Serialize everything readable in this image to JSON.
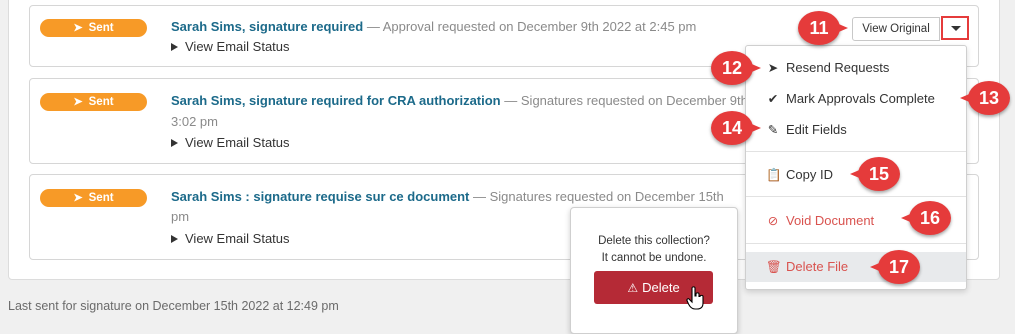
{
  "records": [
    {
      "status": "Sent",
      "title": "Sarah Sims, signature required",
      "meta": "Approval requested on December 9th 2022 at 2:45 pm",
      "meta_cont": "",
      "email_status": "View Email Status"
    },
    {
      "status": "Sent",
      "title": "Sarah Sims, signature required for CRA authorization",
      "meta": "Signatures requested on December 9th",
      "meta_cont": "3:02 pm",
      "email_status": "View Email Status"
    },
    {
      "status": "Sent",
      "title": "Sarah Sims : signature requise sur ce document",
      "meta": "Signatures requested on December 15th",
      "meta_cont": "pm",
      "email_status": "View Email Status"
    }
  ],
  "toolbar": {
    "view_original": "View Original"
  },
  "menu": {
    "items": [
      {
        "label": "Resend Requests",
        "icon": "paper-plane-icon"
      },
      {
        "label": "Mark Approvals Complete",
        "icon": "check-icon"
      },
      {
        "label": "Edit Fields",
        "icon": "pencil-icon"
      },
      {
        "label": "Copy ID",
        "icon": "clipboard-icon"
      },
      {
        "label": "Void Document",
        "icon": "ban-icon"
      },
      {
        "label": "Delete File",
        "icon": "trash-icon"
      }
    ]
  },
  "confirm": {
    "line1": "Delete this collection?",
    "line2": "It cannot be undone.",
    "delete_label": "Delete"
  },
  "callouts": [
    "11",
    "12",
    "13",
    "14",
    "15",
    "16",
    "17"
  ],
  "footer": {
    "text": "Last sent for signature on December 15th 2022 at 12:49 pm"
  },
  "colors": {
    "badge": "#f79a27",
    "link": "#1c6a8a",
    "callout": "#e53b3b",
    "danger": "#d9534f",
    "delete_button": "#b52a36"
  }
}
